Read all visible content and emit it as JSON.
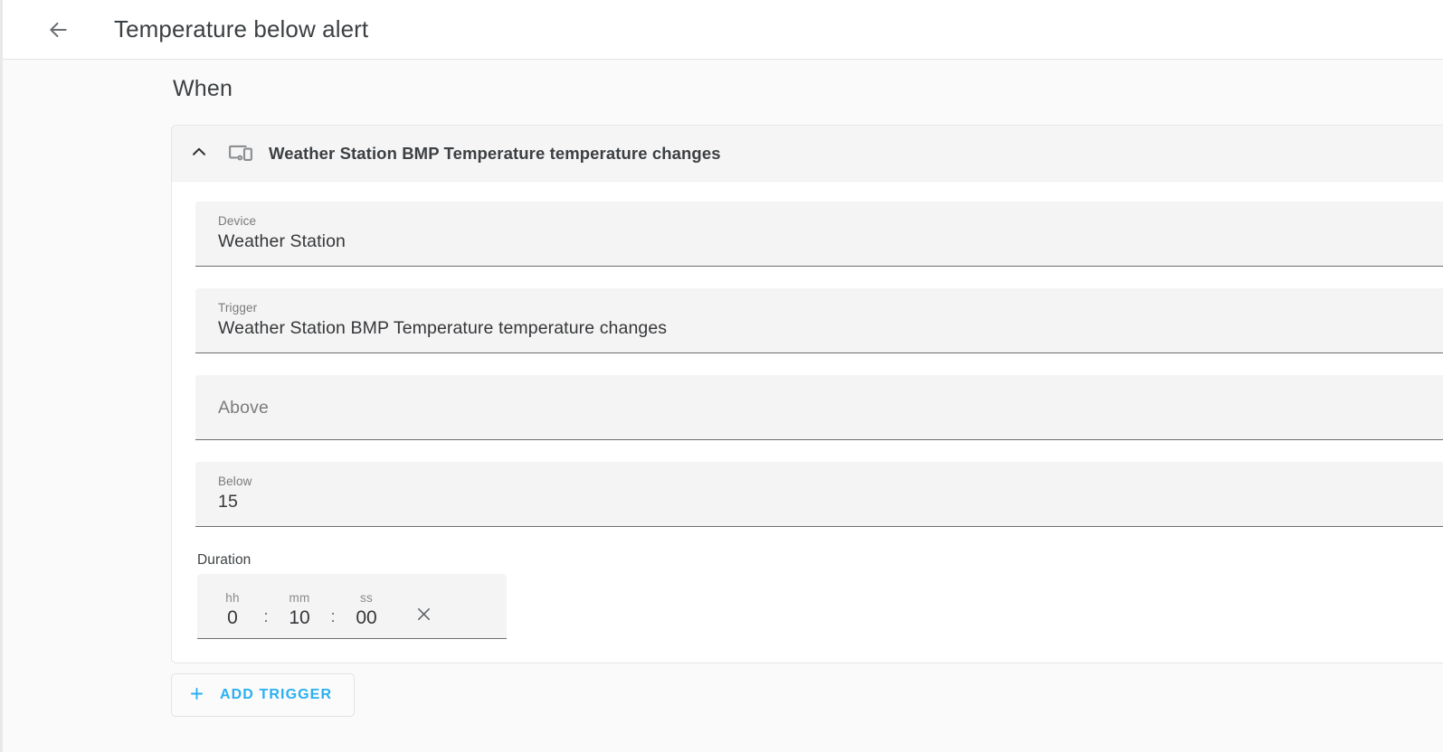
{
  "toolbar": {
    "back_icon": "arrow-back-icon",
    "title": "Temperature below alert"
  },
  "main": {
    "section_title": "When",
    "trigger_card": {
      "collapse_icon": "chevron-up-icon",
      "device_icon": "devices-other-icon",
      "header_title": "Weather Station BMP Temperature temperature changes",
      "fields": [
        {
          "label": "Device",
          "value": "Weather Station"
        },
        {
          "label": "Trigger",
          "value": "Weather Station BMP Temperature temperature changes"
        },
        {
          "label": "Above",
          "value": ""
        },
        {
          "label": "Below",
          "value": "15"
        }
      ],
      "duration": {
        "caption": "Duration",
        "hh_label": "hh",
        "hh_value": "0",
        "mm_label": "mm",
        "mm_value": "10",
        "ss_label": "ss",
        "ss_value": "00",
        "separator": ":",
        "clear_icon": "close-icon"
      }
    },
    "add_trigger": {
      "plus_icon": "plus-icon",
      "label": "ADD TRIGGER"
    }
  },
  "colors": {
    "accent": "#29b0f2",
    "page_bg": "#fafafa",
    "card_header_bg": "#f5f5f5",
    "field_bg": "#f4f4f4",
    "text_primary": "#3c4043",
    "text_secondary": "#7a7a7a"
  }
}
